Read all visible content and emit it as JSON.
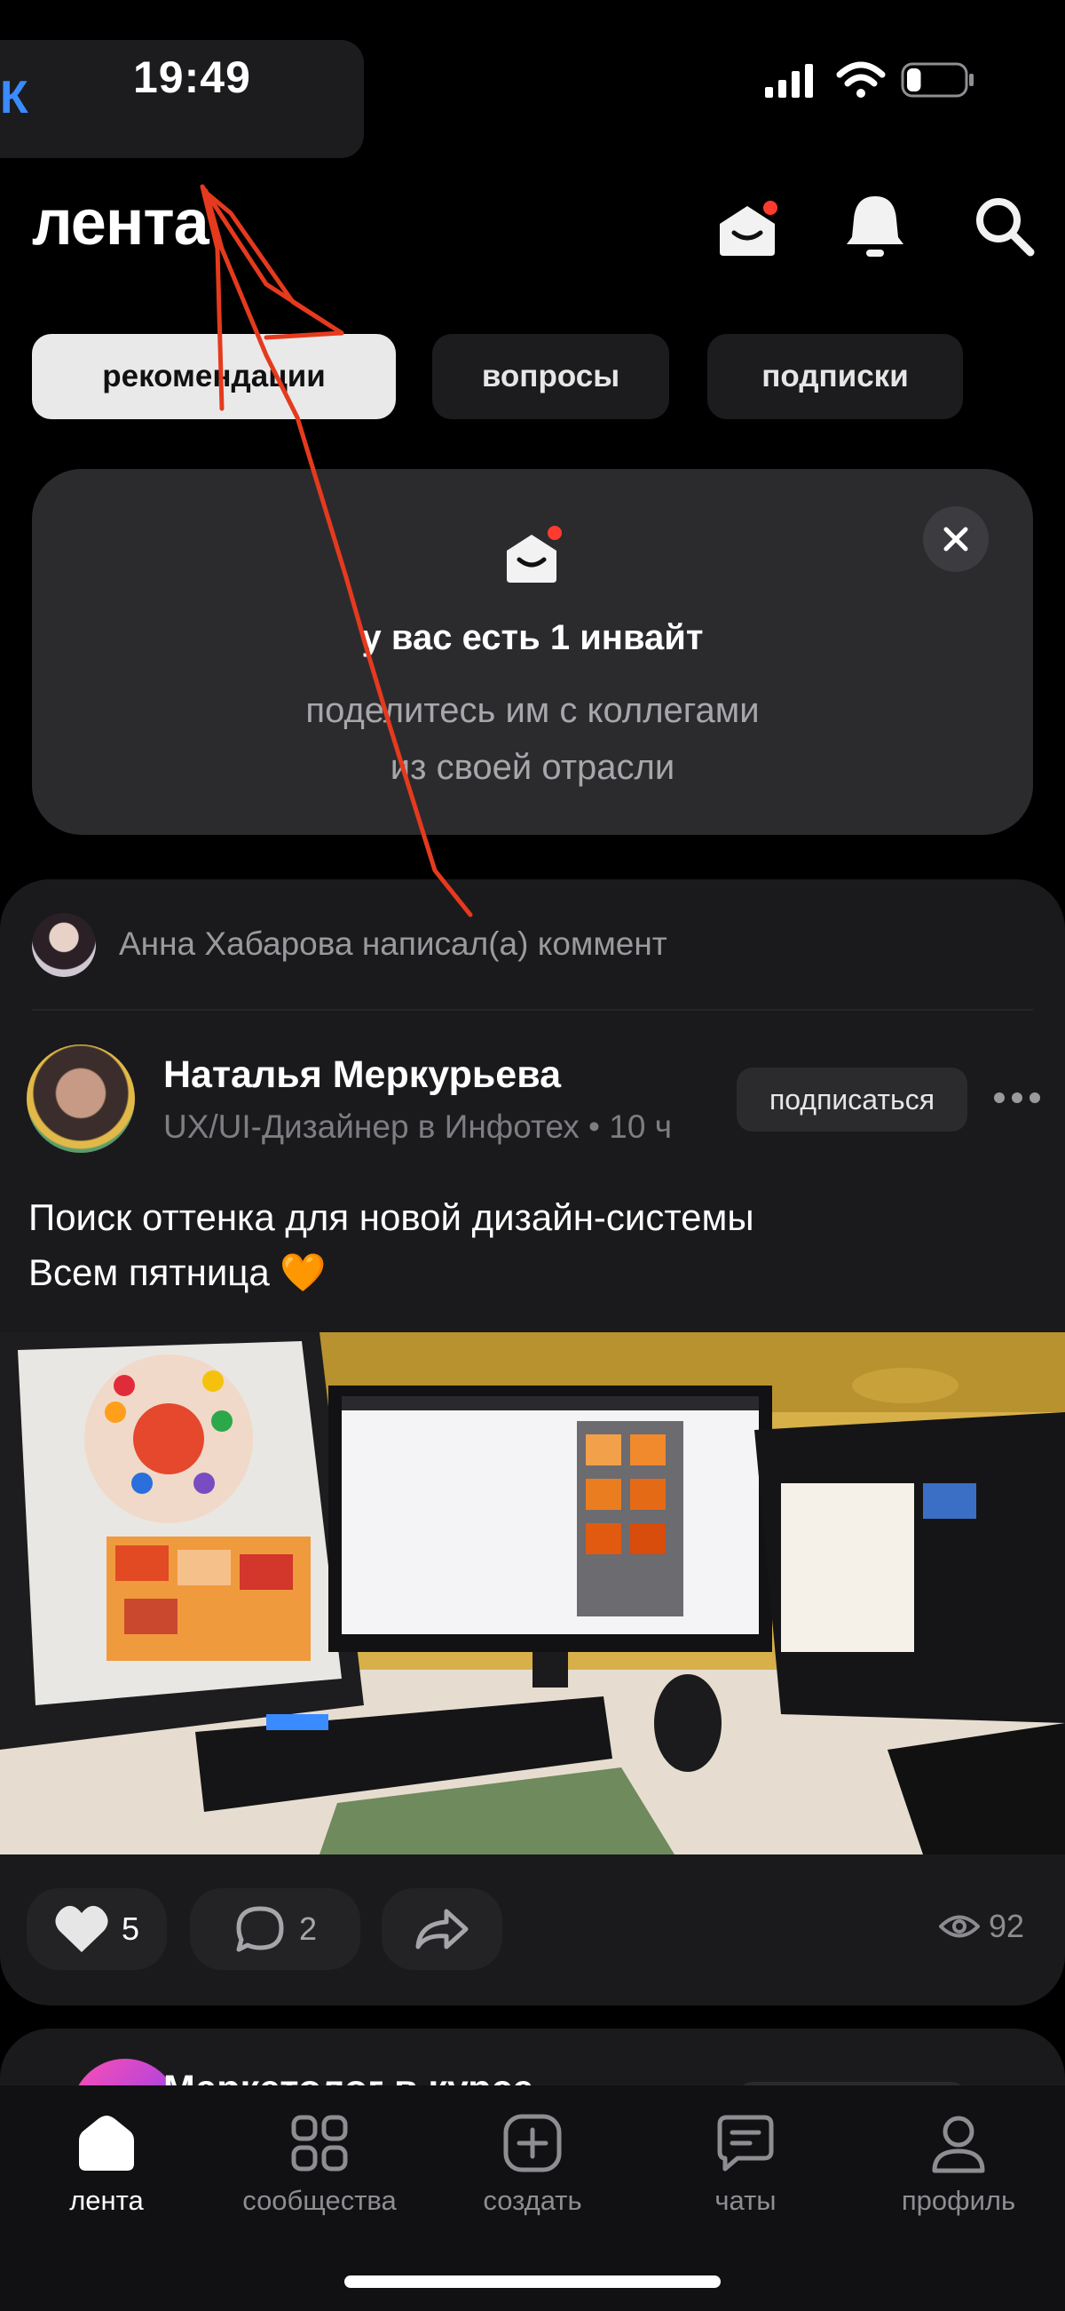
{
  "status_bar": {
    "back_label": "К",
    "time": "19:49",
    "battery_level_percent": 25
  },
  "header": {
    "title": "лента"
  },
  "tabs": [
    {
      "label": "рекомендации",
      "active": true
    },
    {
      "label": "вопросы",
      "active": false
    },
    {
      "label": "подписки",
      "active": false
    }
  ],
  "invite": {
    "title": "у вас есть 1 инвайт",
    "subtitle_line1": "поделитесь им с коллегами",
    "subtitle_line2": "из своей отрасли"
  },
  "post": {
    "comment_note": "Анна Хабарова написал(а) коммент",
    "author_name": "Наталья Меркурьева",
    "author_meta": "UX/UI-Дизайнер в Инфотех • 10 ч",
    "follow_label": "подписаться",
    "text_line1": "Поиск оттенка для новой дизайн-системы",
    "text_line2": "Всем пятница",
    "text_emoji": "🧡",
    "likes": "5",
    "comments": "2",
    "views": "92"
  },
  "next_post": {
    "title": "Маркетолог в курсе"
  },
  "bottom_nav": [
    {
      "label": "лента",
      "icon": "home-icon",
      "active": true
    },
    {
      "label": "сообщества",
      "icon": "grid-icon",
      "active": false
    },
    {
      "label": "создать",
      "icon": "plus-square-icon",
      "active": false
    },
    {
      "label": "чаты",
      "icon": "chat-icon",
      "active": false
    },
    {
      "label": "профиль",
      "icon": "user-icon",
      "active": false
    }
  ],
  "colors": {
    "background": "#000000",
    "card": "#2b2b2e",
    "accent_dot": "#ff3b30",
    "annotation_stroke": "#e53a1e"
  }
}
